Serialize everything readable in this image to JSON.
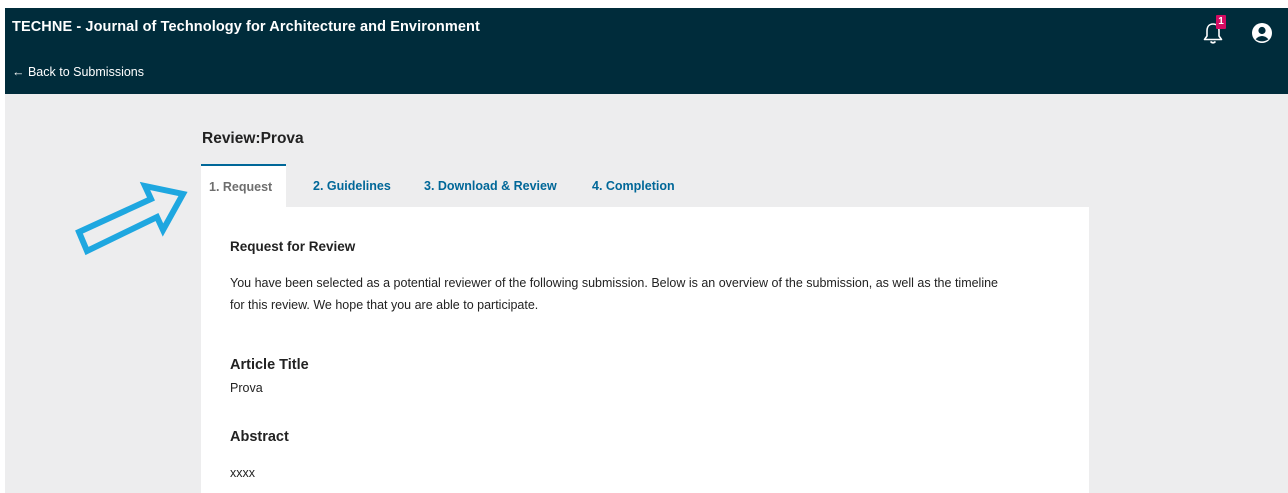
{
  "header": {
    "journal_title": "TECHNE - Journal of Technology for Architecture and Environment",
    "back_link": "← Back to Submissions",
    "notification_count": "1",
    "icons": [
      "bell-icon",
      "user-circle-icon"
    ]
  },
  "page": {
    "title": "Review:Prova"
  },
  "tabs": [
    {
      "label": "1. Request",
      "active": true
    },
    {
      "label": "2. Guidelines",
      "active": false
    },
    {
      "label": "3. Download & Review",
      "active": false
    },
    {
      "label": "4. Completion",
      "active": false
    }
  ],
  "request": {
    "heading": "Request for Review",
    "intro_line1": "You have been selected as a potential reviewer of the following submission. Below is an overview of the submission, as well as the timeline",
    "intro_line2": "for this review. We hope that you are able to participate.",
    "article_title_label": "Article Title",
    "article_title_value": "Prova",
    "abstract_label": "Abstract",
    "abstract_value": "xxxx"
  },
  "colors": {
    "header_bg": "#002c3b",
    "accent": "#006798",
    "badge": "#d40b62",
    "annotation_arrow": "#1ea7e0"
  }
}
